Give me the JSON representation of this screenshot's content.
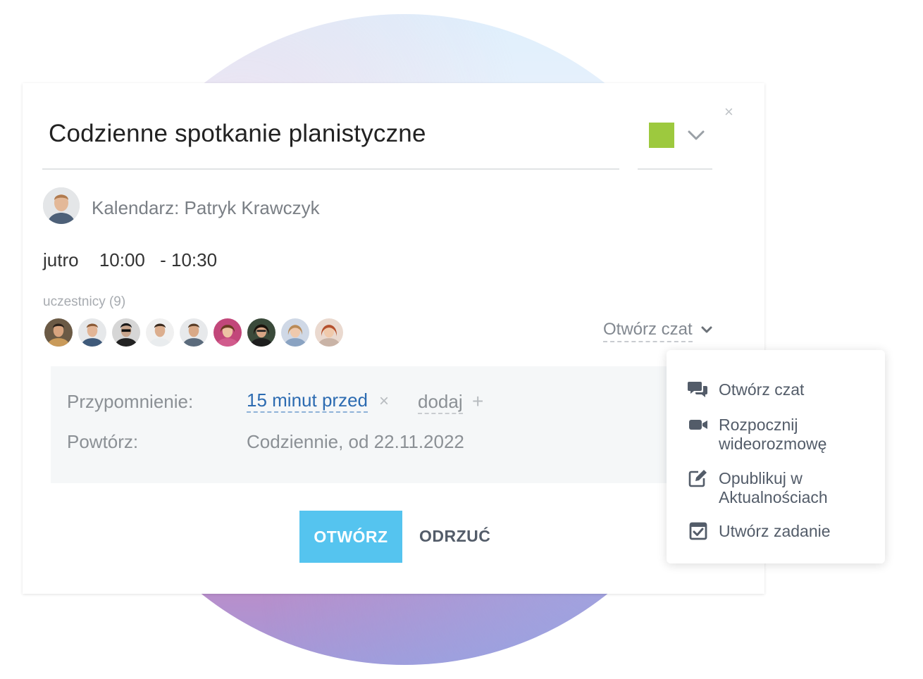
{
  "event": {
    "title": "Codzienne spotkanie planistyczne",
    "color": "#9dc93e",
    "close_label": "×"
  },
  "calendar": {
    "label": "Kalendarz: Patryk Krawczyk"
  },
  "time": {
    "day": "jutro",
    "start": "10:00",
    "end": "- 10:30"
  },
  "participants": {
    "label": "uczestnicy (9)",
    "count": 9
  },
  "chat": {
    "label": "Otwórz czat"
  },
  "details": {
    "reminder_label": "Przypomnienie:",
    "reminder_value": "15 minut przed",
    "reminder_remove": "×",
    "add_label": "dodaj",
    "add_plus": "+",
    "repeat_label": "Powtórz:",
    "repeat_value": "Codziennie, od 22.11.2022"
  },
  "actions": {
    "open_label": "OTWÓRZ",
    "reject_label": "ODRZUĆ"
  },
  "menu": {
    "items": [
      {
        "label": "Otwórz czat",
        "icon": "chat-bubbles-icon"
      },
      {
        "label": "Rozpocznij wideorozmowę",
        "icon": "video-camera-icon"
      },
      {
        "label": "Opublikuj w Aktualnościach",
        "icon": "edit-post-icon"
      },
      {
        "label": "Utwórz zadanie",
        "icon": "task-checkbox-icon"
      }
    ]
  },
  "colors": {
    "accent": "#55c4ef",
    "link": "#2c6bb1",
    "event_color": "#9dc93e"
  }
}
